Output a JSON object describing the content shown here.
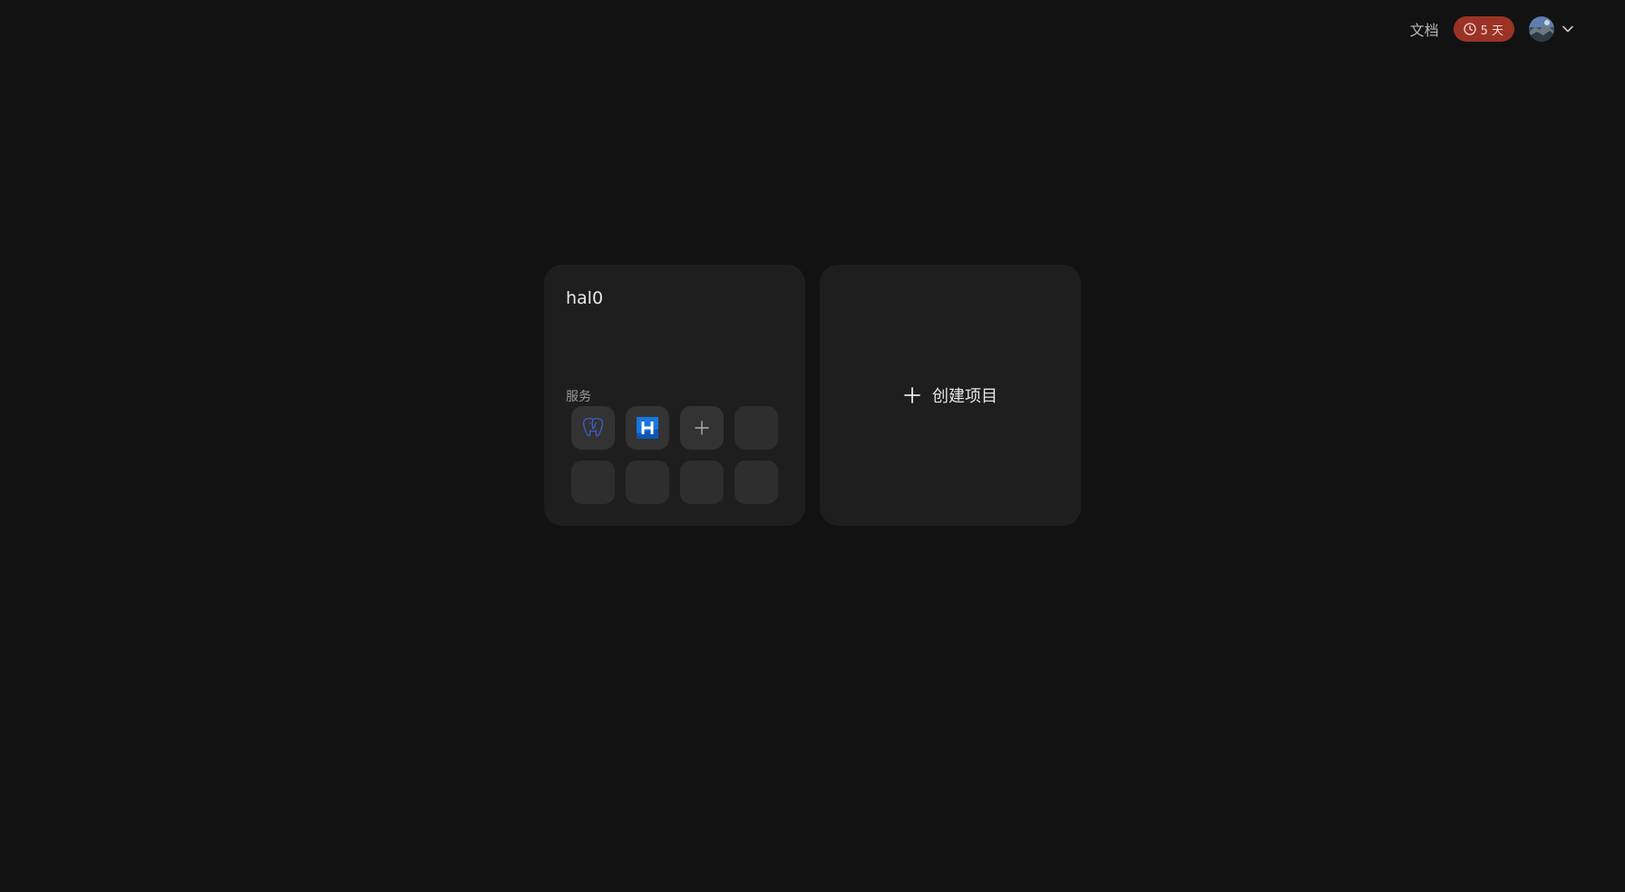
{
  "header": {
    "docs_label": "文档",
    "trial_badge": "5 天",
    "colors": {
      "badge": "#9a3326"
    }
  },
  "projects": [
    {
      "name": "hal0",
      "services_label": "服务",
      "services": [
        {
          "icon": "postgresql-elephant-icon"
        },
        {
          "icon": "h-logo-icon"
        },
        {
          "icon": "plus-icon"
        },
        {
          "icon": "empty"
        },
        {
          "icon": "empty"
        },
        {
          "icon": "empty"
        },
        {
          "icon": "empty"
        },
        {
          "icon": "empty"
        }
      ]
    }
  ],
  "create_project_label": "创建项目"
}
